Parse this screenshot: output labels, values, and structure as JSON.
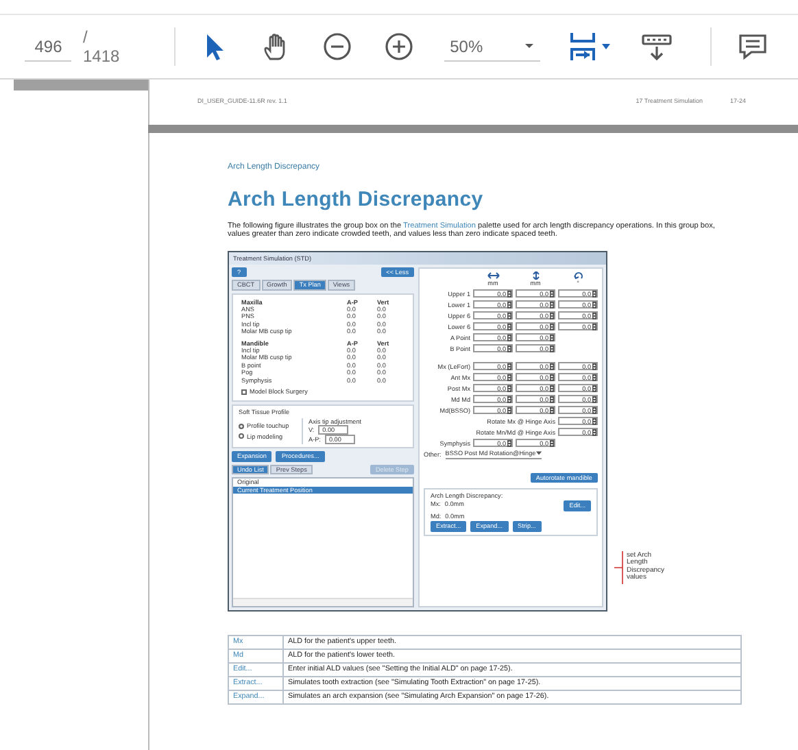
{
  "toolbar": {
    "page_number": "496",
    "page_count": "/ 1418",
    "zoom": "50%",
    "tools": [
      {
        "kind": "select",
        "selected": true
      },
      {
        "kind": "hand",
        "selected": false
      }
    ]
  },
  "document": {
    "running_header": {
      "left": "DI_USER_GUIDE-11.6R rev. 1.1",
      "section": "17 Treatment Simulation",
      "page": "17-24"
    },
    "breadcrumb": "Arch Length Discrepancy",
    "heading": "Arch Length Discrepancy",
    "intro": {
      "before": "The following figure illustrates the group box on the ",
      "link": "Treatment Simulation",
      "after": " palette used for arch length discrepancy operations. In this group box, values greater than zero indicate crowded teeth, and values less than zero indicate spaced teeth."
    },
    "figure": {
      "title": "Treatment Simulation (STD)",
      "help_button": "?",
      "less_button": "<< Less",
      "tabs": [
        {
          "label": "CBCT",
          "selected": false
        },
        {
          "label": "Growth",
          "selected": false
        },
        {
          "label": "Tx Plan",
          "selected": true
        },
        {
          "label": "Views",
          "selected": false
        }
      ],
      "landmark_tables": [
        {
          "heading": "Maxilla",
          "columns": [
            "A-P",
            "Vert"
          ],
          "rows": [
            {
              "label": "ANS",
              "values": [
                "0.0",
                "0.0"
              ]
            },
            {
              "label": "PNS",
              "values": [
                "0.0",
                "0.0"
              ]
            },
            {
              "label": "Incl tip",
              "values": [
                "0.0",
                "0.0"
              ]
            },
            {
              "label": "Molar MB cusp tip",
              "values": [
                "0.0",
                "0.0"
              ]
            }
          ]
        },
        {
          "heading": "Mandible",
          "columns": [
            "A-P",
            "Vert"
          ],
          "rows": [
            {
              "label": "Incl tip",
              "values": [
                "0.0",
                "0.0"
              ]
            },
            {
              "label": "Molar MB cusp tip",
              "values": [
                "0.0",
                "0.0"
              ]
            },
            {
              "label": "B point",
              "values": [
                "0.0",
                "0.0"
              ]
            },
            {
              "label": "Pog",
              "values": [
                "0.0",
                "0.0"
              ]
            },
            {
              "label": "Symphysis",
              "values": [
                "0.0",
                "0.0"
              ]
            }
          ]
        }
      ],
      "model_block_surgery": {
        "label": "Model Block Surgery",
        "checked": false
      },
      "soft_tissue": {
        "title": "Soft Tissue Profile",
        "options": [
          {
            "label": "Profile touchup",
            "selected": true
          },
          {
            "label": "Lip modeling",
            "selected": false
          }
        ],
        "axis_title": "Axis tip adjustment",
        "axis_rows": [
          {
            "label": "V:",
            "value": "0.00"
          },
          {
            "label": "A-P:",
            "value": "0.00"
          }
        ]
      },
      "action_buttons": [
        "Expansion",
        "Procedures..."
      ],
      "list_tabs": [
        {
          "label": "Undo List",
          "selected": true
        },
        {
          "label": "Prev Steps",
          "selected": false
        }
      ],
      "delete_button": {
        "label": "Delete Step",
        "disabled": true
      },
      "list_items": [
        {
          "label": "Original",
          "selected": false
        },
        {
          "label": "Current Treatment Position",
          "selected": true
        }
      ],
      "column_icons": [
        {
          "kind": "horizontal",
          "unit": "mm"
        },
        {
          "kind": "vertical",
          "unit": "mm"
        },
        {
          "kind": "rotate",
          "unit": "°"
        }
      ],
      "movement_groups": [
        [
          {
            "kind": "spin",
            "label": "Upper 1",
            "values": [
              "0.0",
              "0.0",
              "0.0"
            ]
          },
          {
            "kind": "spin",
            "label": "Lower 1",
            "values": [
              "0.0",
              "0.0",
              "0.0"
            ]
          },
          {
            "kind": "spin",
            "label": "Upper 6",
            "values": [
              "0.0",
              "0.0",
              "0.0"
            ]
          },
          {
            "kind": "spin",
            "label": "Lower 6",
            "values": [
              "0.0",
              "0.0",
              "0.0"
            ]
          },
          {
            "kind": "spin",
            "label": "A Point",
            "values": [
              "0.0",
              "0.0"
            ]
          },
          {
            "kind": "spin",
            "label": "B Point",
            "values": [
              "0.0",
              "0.0"
            ]
          }
        ],
        [
          {
            "kind": "spin",
            "label": "Mx (LeFort)",
            "values": [
              "0.0",
              "0.0",
              "0.0"
            ]
          },
          {
            "kind": "spin",
            "label": "Ant Mx",
            "values": [
              "0.0",
              "0.0",
              "0.0"
            ]
          },
          {
            "kind": "spin",
            "label": "Post Mx",
            "values": [
              "0.0",
              "0.0",
              "0.0"
            ]
          },
          {
            "kind": "spin",
            "label": "Md Md",
            "values": [
              "0.0",
              "0.0",
              "0.0"
            ]
          },
          {
            "kind": "spin",
            "label": "Md(BSSO)",
            "values": [
              "0.0",
              "0.0",
              "0.0"
            ]
          },
          {
            "kind": "hinge",
            "label": "Rotate Mx @ Hinge Axis",
            "values": [
              "0.0"
            ]
          },
          {
            "kind": "hinge",
            "label": "Rotate Mn/Md @ Hinge Axis",
            "values": [
              "0.0"
            ]
          },
          {
            "kind": "spin",
            "label": "Symphysis",
            "values": [
              "0.0",
              "0.0"
            ]
          }
        ]
      ],
      "other": {
        "label": "Other:",
        "value": "BSSO Post Md Rotation@Hinge"
      },
      "autorotate_button": "Autorotate mandible",
      "ald": {
        "title": "Arch Length Discrepancy:",
        "rows": [
          {
            "label": "Mx:",
            "value": "0.0mm"
          },
          {
            "label": "Md:",
            "value": "0.0mm"
          }
        ],
        "edit_button": "Edit...",
        "buttons": [
          "Extract...",
          "Expand...",
          "Strip..."
        ]
      }
    },
    "callout": "set Arch Length Discrepancy values",
    "table": [
      {
        "term": "Mx",
        "description": "ALD for the patient's upper teeth."
      },
      {
        "term": "Md",
        "description": "ALD for the patient's lower teeth."
      },
      {
        "term": "Edit...",
        "description": "Enter initial ALD values (see \"Setting the Initial ALD\" on page 17-25)."
      },
      {
        "term": "Extract...",
        "description": "Simulates tooth extraction (see \"Simulating Tooth Extraction\" on page 17-25)."
      },
      {
        "term": "Expand...",
        "description": "Simulates an arch expansion (see \"Simulating Arch Expansion\" on page 17-26)."
      }
    ]
  }
}
